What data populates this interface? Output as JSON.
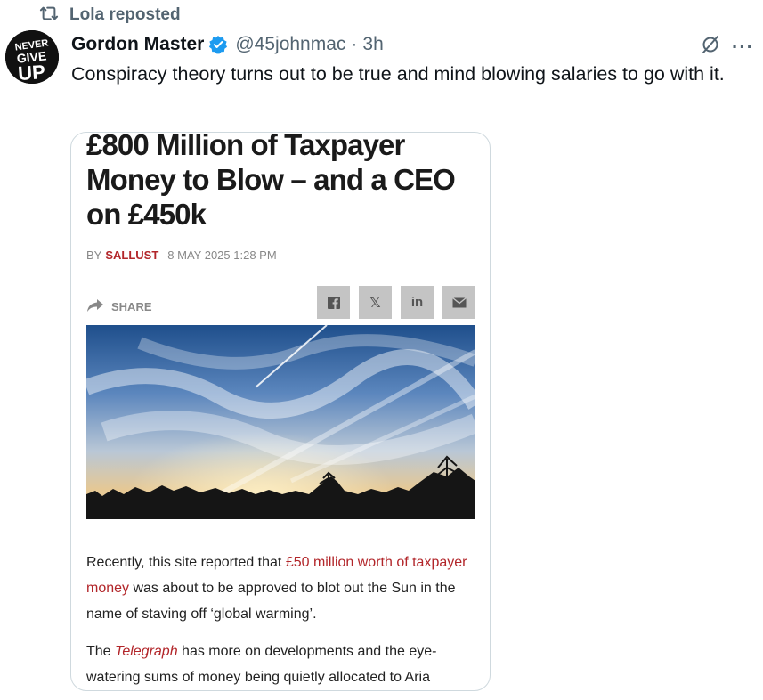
{
  "repost": {
    "label": "Lola reposted",
    "icon": "repost-icon"
  },
  "author": {
    "name": "Gordon Master",
    "handle": "@45johnmac",
    "separator": "·",
    "time": "3h",
    "avatar_text": [
      "NEVER",
      "GIVE",
      "UP"
    ]
  },
  "actions": {
    "grok_icon": "grok-icon",
    "more_label": "···"
  },
  "tweet": {
    "text": "Conspiracy theory turns out to be true and mind blowing salaries to go with it."
  },
  "article": {
    "headline": "£800 Million of Taxpayer Money to Blow – and a CEO on £450k",
    "by_label": "BY",
    "author": "SALLUST",
    "date": "8 MAY 2025 1:28 PM",
    "share_label": "SHARE",
    "social_buttons": [
      "facebook-icon",
      "x-icon",
      "linkedin-icon",
      "email-icon"
    ],
    "linkedin_label": "in",
    "x_label": "𝕏",
    "para1_prefix": "Recently, this site reported that ",
    "para1_link": "£50 million worth of taxpayer money",
    "para1_suffix": " was about to be approved to blot out the Sun in the name of staving off ‘global warming’.",
    "para2_prefix": "The ",
    "para2_italic": "Telegraph",
    "para2_suffix": " has more on developments and the eye-watering sums of money being quietly allocated to Aria"
  },
  "colors": {
    "accent_red": "#b2262a",
    "verified_blue": "#1d9bf0",
    "muted": "#536471"
  }
}
